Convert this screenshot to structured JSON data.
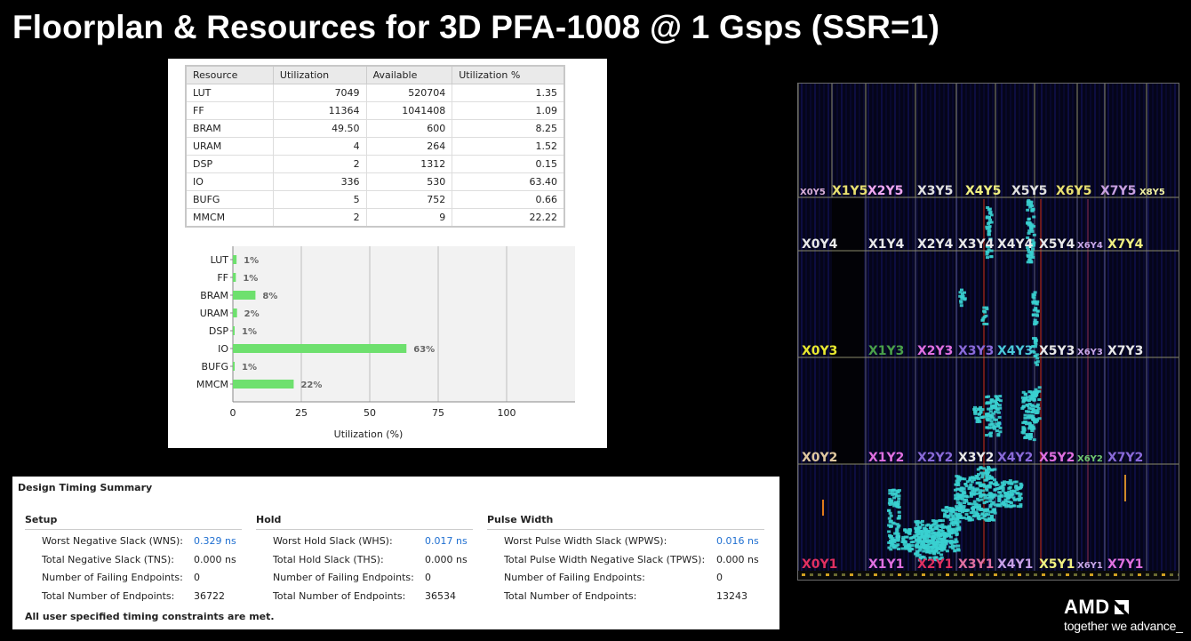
{
  "slide": {
    "title": "Floorplan & Resources for 3D PFA-1008 @ 1 Gsps (SSR=1)"
  },
  "utilization_table": {
    "headers": [
      "Resource",
      "Utilization",
      "Available",
      "Utilization %"
    ],
    "rows": [
      [
        "LUT",
        "7049",
        "520704",
        "1.35"
      ],
      [
        "FF",
        "11364",
        "1041408",
        "1.09"
      ],
      [
        "BRAM",
        "49.50",
        "600",
        "8.25"
      ],
      [
        "URAM",
        "4",
        "264",
        "1.52"
      ],
      [
        "DSP",
        "2",
        "1312",
        "0.15"
      ],
      [
        "IO",
        "336",
        "530",
        "63.40"
      ],
      [
        "BUFG",
        "5",
        "752",
        "0.66"
      ],
      [
        "MMCM",
        "2",
        "9",
        "22.22"
      ]
    ]
  },
  "chart_data": {
    "type": "bar",
    "orientation": "horizontal",
    "categories": [
      "LUT",
      "FF",
      "BRAM",
      "URAM",
      "DSP",
      "IO",
      "BUFG",
      "MMCM"
    ],
    "values": [
      1.35,
      1.09,
      8.25,
      1.52,
      0.15,
      63.4,
      0.66,
      22.22
    ],
    "data_labels": [
      "1%",
      "1%",
      "8%",
      "2%",
      "1%",
      "63%",
      "1%",
      "22%"
    ],
    "xlabel": "Utilization (%)",
    "xticks": [
      "0",
      "25",
      "50",
      "75",
      "100"
    ],
    "xlim": [
      0,
      125
    ],
    "grid": true,
    "bar_color": "#6ee06e"
  },
  "timing": {
    "title": "Design Timing Summary",
    "footer": "All user specified timing constraints are met.",
    "setup": {
      "heading": "Setup",
      "rows": [
        {
          "label": "Worst Negative Slack (WNS):",
          "value": "0.329 ns",
          "link": true
        },
        {
          "label": "Total Negative Slack (TNS):",
          "value": "0.000 ns",
          "link": false
        },
        {
          "label": "Number of Failing Endpoints:",
          "value": "0",
          "link": false
        },
        {
          "label": "Total Number of Endpoints:",
          "value": "36722",
          "link": false
        }
      ]
    },
    "hold": {
      "heading": "Hold",
      "rows": [
        {
          "label": "Worst Hold Slack (WHS):",
          "value": "0.017 ns",
          "link": true
        },
        {
          "label": "Total Hold Slack (THS):",
          "value": "0.000 ns",
          "link": false
        },
        {
          "label": "Number of Failing Endpoints:",
          "value": "0",
          "link": false
        },
        {
          "label": "Total Number of Endpoints:",
          "value": "36534",
          "link": false
        }
      ]
    },
    "pulse": {
      "heading": "Pulse Width",
      "rows": [
        {
          "label": "Worst Pulse Width Slack (WPWS):",
          "value": "0.016 ns",
          "link": true
        },
        {
          "label": "Total Pulse Width Negative Slack (TPWS):",
          "value": "0.000 ns",
          "link": false
        },
        {
          "label": "Number of Failing Endpoints:",
          "value": "0",
          "link": false
        },
        {
          "label": "Total Number of Endpoints:",
          "value": "13243",
          "link": false
        }
      ]
    }
  },
  "floorplan": {
    "rows": [
      {
        "y": 5,
        "labels": [
          [
            "X0Y5",
            "#d9b0d9"
          ],
          [
            "X1Y5",
            "#e8e070"
          ],
          [
            "X2Y5",
            "#f0a8f0"
          ],
          [
            "X3Y5",
            "#e0e0e0"
          ],
          [
            "X4Y5",
            "#f0f080"
          ],
          [
            "X5Y5",
            "#e0e0e0"
          ],
          [
            "X6Y5",
            "#e8e070"
          ],
          [
            "X7Y5",
            "#c8a0e0"
          ],
          [
            "X8Y5",
            "#f0f0a0"
          ]
        ]
      },
      {
        "y": 4,
        "labels": [
          [
            "X0Y4",
            "#e8e8e8"
          ],
          [
            "X1Y4",
            "#e8e8e8"
          ],
          [
            "X2Y4",
            "#e8e8e8"
          ],
          [
            "X3Y4",
            "#e8e8e8"
          ],
          [
            "X4Y4",
            "#e8e8e8"
          ],
          [
            "X5Y4",
            "#e8e8e8"
          ],
          [
            "X6Y4",
            "#c8a8e8"
          ],
          [
            "X7Y4",
            "#f0f080"
          ]
        ]
      },
      {
        "y": 3,
        "labels": [
          [
            "X0Y3",
            "#e8e830"
          ],
          [
            "X1Y3",
            "#4aa04a"
          ],
          [
            "X2Y3",
            "#e070e0"
          ],
          [
            "X3Y3",
            "#8a6ad8"
          ],
          [
            "X4Y3",
            "#4ac8d8"
          ],
          [
            "X5Y3",
            "#e8e8e8"
          ],
          [
            "X6Y3",
            "#c8a8e8"
          ],
          [
            "X7Y3",
            "#e8e8e8"
          ]
        ]
      },
      {
        "y": 2,
        "labels": [
          [
            "X0Y2",
            "#e0c8a0"
          ],
          [
            "X1Y2",
            "#e070e0"
          ],
          [
            "X2Y2",
            "#8a6ad8"
          ],
          [
            "X3Y2",
            "#e8e8e8"
          ],
          [
            "X4Y2",
            "#8a6ad8"
          ],
          [
            "X5Y2",
            "#e070e0"
          ],
          [
            "X6Y2",
            "#70c870"
          ],
          [
            "X7Y2",
            "#8a6ad8"
          ]
        ]
      },
      {
        "y": 1,
        "labels": [
          [
            "X0Y1",
            "#e03060"
          ],
          [
            "X1Y1",
            "#e070e0"
          ],
          [
            "X2Y1",
            "#e03060"
          ],
          [
            "X3Y1",
            "#e070a0"
          ],
          [
            "X4Y1",
            "#c8a0e8"
          ],
          [
            "X5Y1",
            "#f0f080"
          ],
          [
            "X6Y1",
            "#c8a8e8"
          ],
          [
            "X7Y1",
            "#e070e0"
          ]
        ]
      }
    ]
  },
  "brand": {
    "name": "AMD",
    "tagline": "together we advance_"
  }
}
